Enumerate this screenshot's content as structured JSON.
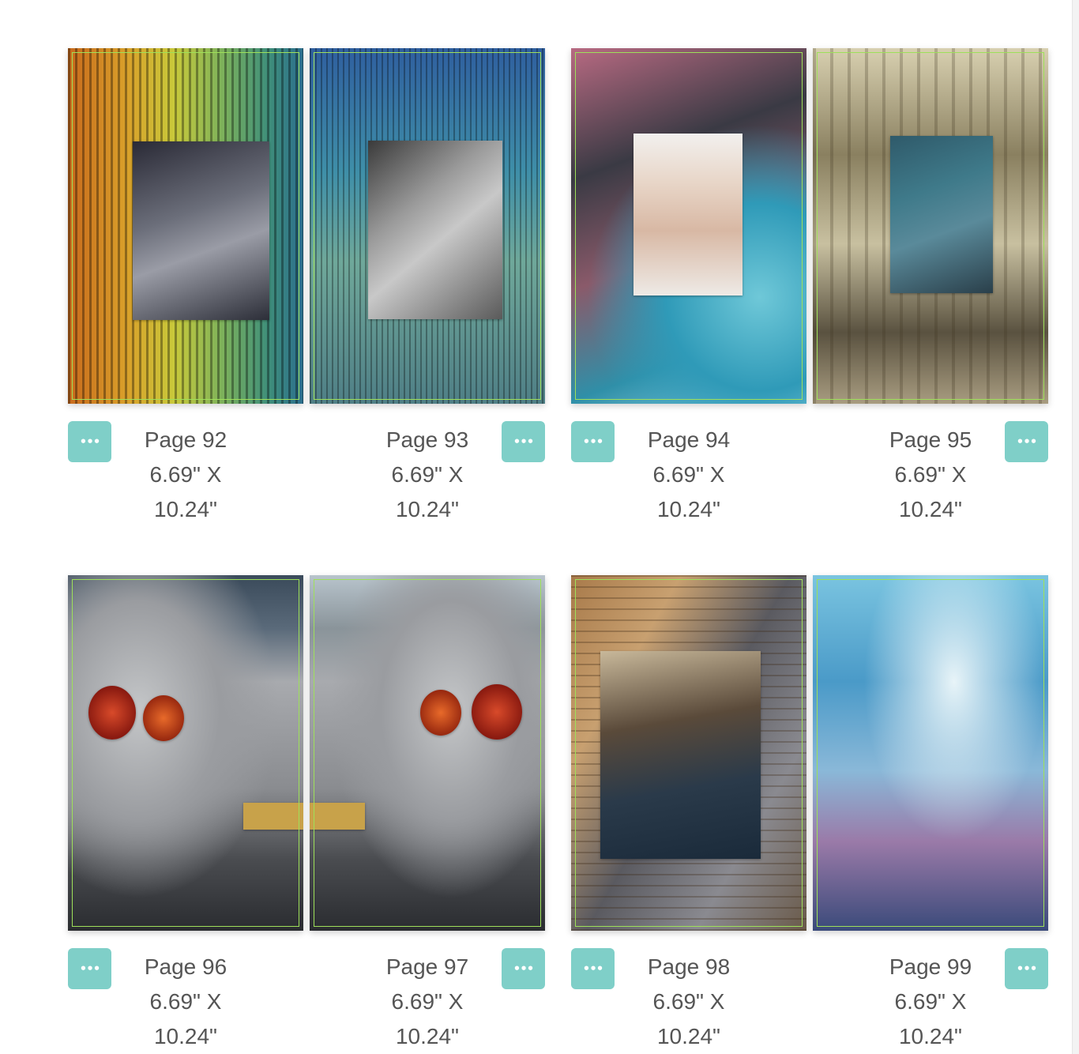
{
  "menu_label": "•••",
  "spreads": [
    {
      "pages": [
        {
          "name": "Page 92",
          "width": "6.69\" X",
          "height": "10.24\""
        },
        {
          "name": "Page 93",
          "width": "6.69\" X",
          "height": "10.24\""
        }
      ]
    },
    {
      "pages": [
        {
          "name": "Page 94",
          "width": "6.69\" X",
          "height": "10.24\""
        },
        {
          "name": "Page 95",
          "width": "6.69\" X",
          "height": "10.24\""
        }
      ]
    },
    {
      "pages": [
        {
          "name": "Page 96",
          "width": "6.69\" X",
          "height": "10.24\""
        },
        {
          "name": "Page 97",
          "width": "6.69\" X",
          "height": "10.24\""
        }
      ]
    },
    {
      "pages": [
        {
          "name": "Page 98",
          "width": "6.69\" X",
          "height": "10.24\""
        },
        {
          "name": "Page 99",
          "width": "6.69\" X",
          "height": "10.24\""
        }
      ]
    }
  ],
  "colors": {
    "menu_button": "#7fcfc8",
    "bleed_guide": "#9ee05a",
    "caption_text": "#555555"
  }
}
